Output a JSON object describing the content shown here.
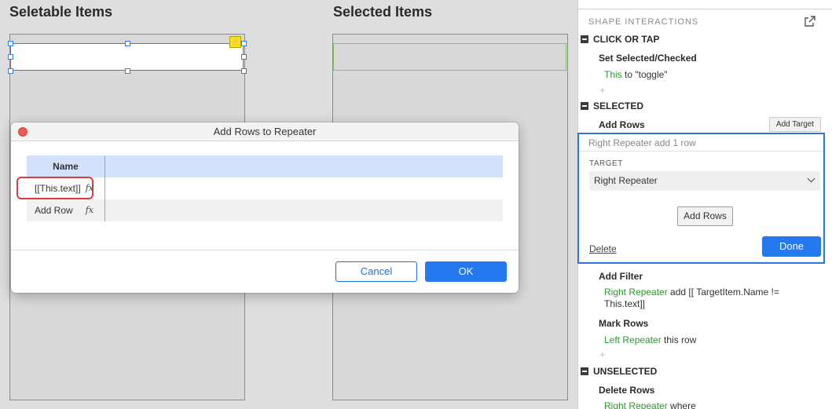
{
  "canvas": {
    "left_title": "Seletable Items",
    "right_title": "Selected Items"
  },
  "dialog": {
    "title": "Add Rows to Repeater",
    "column_header": "Name",
    "rows": [
      {
        "name": "[[This.text]]",
        "fx": "fx"
      },
      {
        "name": "Add Row",
        "fx": "fx"
      }
    ],
    "cancel_label": "Cancel",
    "ok_label": "OK"
  },
  "panel": {
    "header": "SHAPE INTERACTIONS",
    "sections": {
      "click": "CLICK OR TAP",
      "selected": "SELECTED",
      "unselected": "UNSELECTED"
    },
    "click_action": {
      "title": "Set Selected/Checked",
      "target": "This",
      "rest": " to \"toggle\""
    },
    "add_rows": {
      "title": "Add Rows",
      "add_target_label": "Add Target",
      "summary": "Right Repeater add 1 row",
      "target_label": "TARGET",
      "target_value": "Right Repeater",
      "add_rows_button": "Add Rows",
      "delete_label": "Delete",
      "done_label": "Done"
    },
    "add_filter": {
      "title": "Add Filter",
      "target": "Right Repeater",
      "rest": " add [[  TargetItem.Name   !=",
      "rest2": "This.text]]"
    },
    "mark_rows": {
      "title": "Mark Rows",
      "target": "Left Repeater",
      "rest": " this row"
    },
    "delete_rows": {
      "title": "Delete Rows",
      "target": "Right Repeater",
      "rest": " where"
    },
    "plus": "+"
  },
  "colors": {
    "accent": "#2678ee",
    "green_text": "#2a9a2a",
    "highlight_red": "#e03a3a",
    "selection_blue": "#2d7ff0"
  }
}
